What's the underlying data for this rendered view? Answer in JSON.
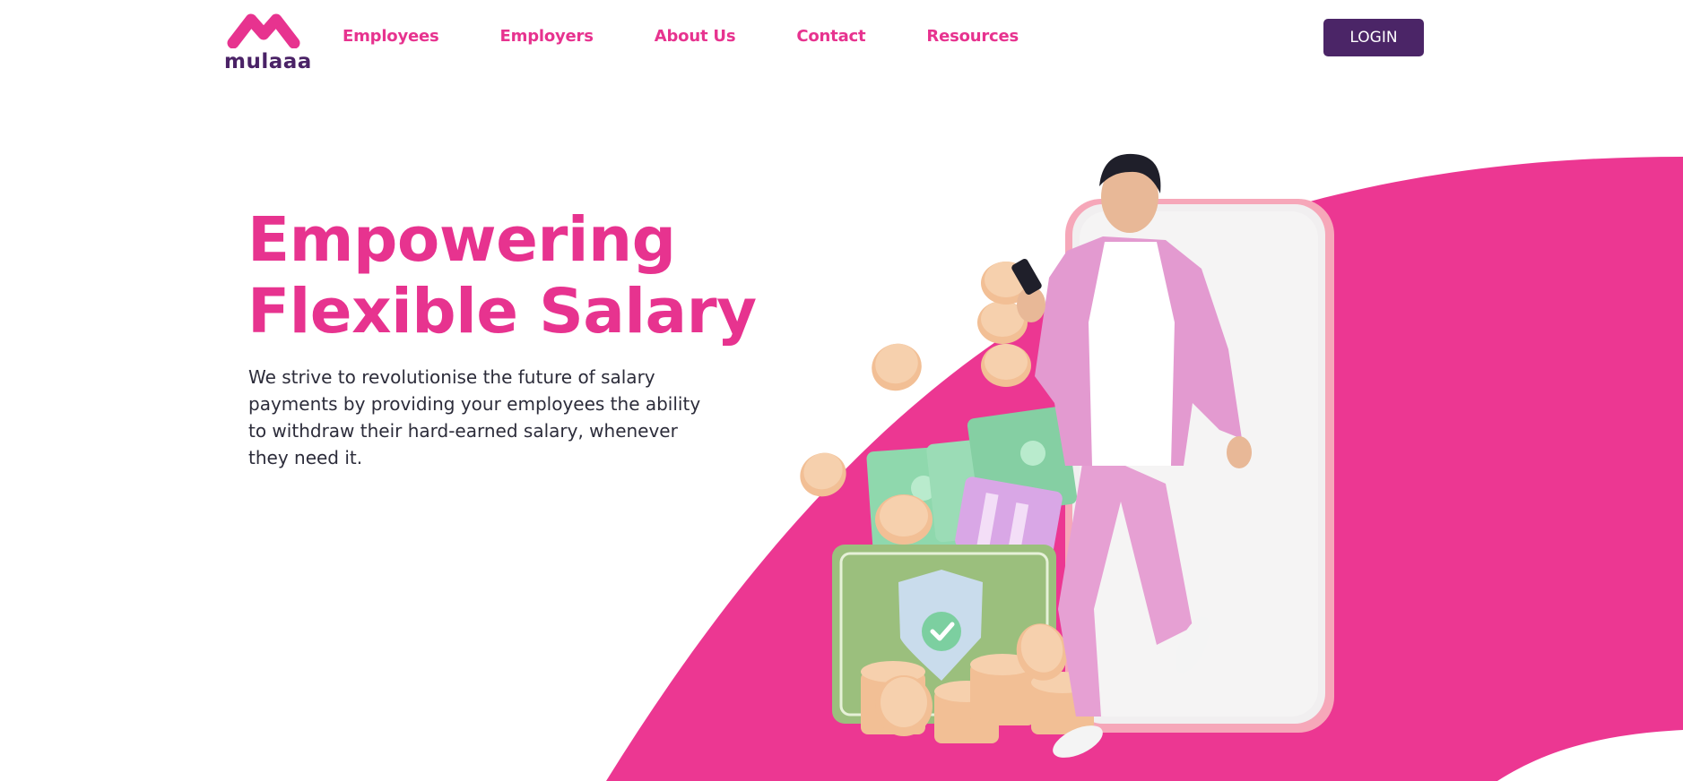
{
  "brand": {
    "name": "mulaaa",
    "colors": {
      "pink": "#e7338f",
      "purple": "#4b2567",
      "text": "#2c2c3a"
    }
  },
  "nav": {
    "items": [
      {
        "label": "Employees"
      },
      {
        "label": "Employers"
      },
      {
        "label": "About Us"
      },
      {
        "label": "Contact"
      },
      {
        "label": "Resources"
      }
    ]
  },
  "header": {
    "login_label": "LOGIN"
  },
  "hero": {
    "title_line1": "Empowering",
    "title_line2": "Flexible Salary",
    "description": "We strive to revolutionise the future of salary payments by providing your employees the ability to withdraw their hard-earned salary, whenever they need it."
  }
}
